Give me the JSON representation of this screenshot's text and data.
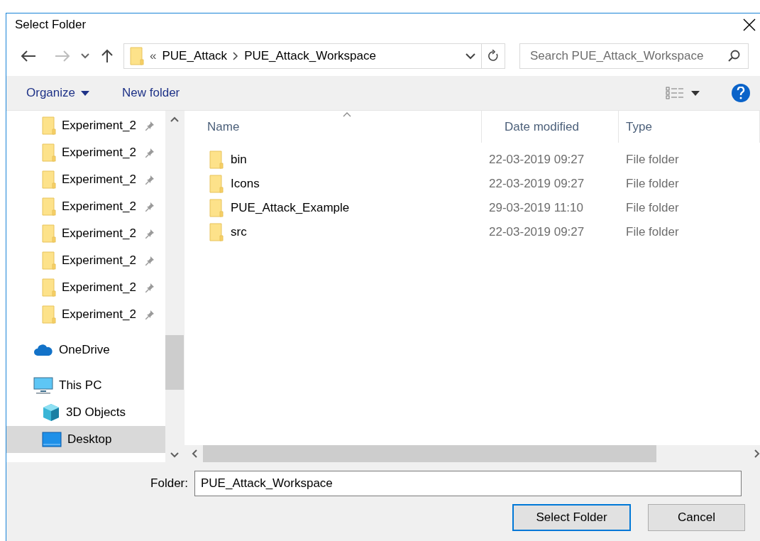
{
  "window": {
    "title": "Select Folder"
  },
  "address_bar": {
    "overflow": "«",
    "path": [
      "PUE_Attack",
      "PUE_Attack_Workspace"
    ]
  },
  "search": {
    "placeholder": "Search PUE_Attack_Workspace"
  },
  "toolbar": {
    "organize": "Organize",
    "new_folder": "New folder"
  },
  "sidebar": {
    "items": [
      {
        "label": "Experiment_2",
        "kind": "pinned",
        "selected": false
      },
      {
        "label": "Experiment_2",
        "kind": "pinned",
        "selected": false
      },
      {
        "label": "Experiment_2",
        "kind": "pinned",
        "selected": false
      },
      {
        "label": "Experiment_2",
        "kind": "pinned",
        "selected": false
      },
      {
        "label": "Experiment_2",
        "kind": "pinned",
        "selected": false
      },
      {
        "label": "Experiment_2",
        "kind": "pinned",
        "selected": false
      },
      {
        "label": "Experiment_2",
        "kind": "pinned",
        "selected": false
      },
      {
        "label": "Experiment_2",
        "kind": "pinned",
        "selected": false
      },
      {
        "label": "OneDrive",
        "kind": "onedrive",
        "selected": false
      },
      {
        "label": "This PC",
        "kind": "pc",
        "selected": false,
        "children": [
          {
            "label": "3D Objects",
            "kind": "objects3d",
            "selected": false
          },
          {
            "label": "Desktop",
            "kind": "desktop",
            "selected": true
          }
        ]
      }
    ]
  },
  "table": {
    "columns": [
      {
        "label": "Name",
        "sorted": true
      },
      {
        "label": "Date modified",
        "sorted": false
      },
      {
        "label": "Type",
        "sorted": false
      }
    ],
    "rows": [
      {
        "name": "bin",
        "date_modified": "22-03-2019 09:27",
        "type": "File folder"
      },
      {
        "name": "Icons",
        "date_modified": "22-03-2019 09:27",
        "type": "File folder"
      },
      {
        "name": "PUE_Attack_Example",
        "date_modified": "29-03-2019 11:10",
        "type": "File folder"
      },
      {
        "name": "src",
        "date_modified": "22-03-2019 09:27",
        "type": "File folder"
      }
    ]
  },
  "folder_field": {
    "label": "Folder:",
    "value": "PUE_Attack_Workspace"
  },
  "buttons": [
    {
      "label": "Select Folder",
      "default": true
    },
    {
      "label": "Cancel",
      "default": false
    }
  ]
}
